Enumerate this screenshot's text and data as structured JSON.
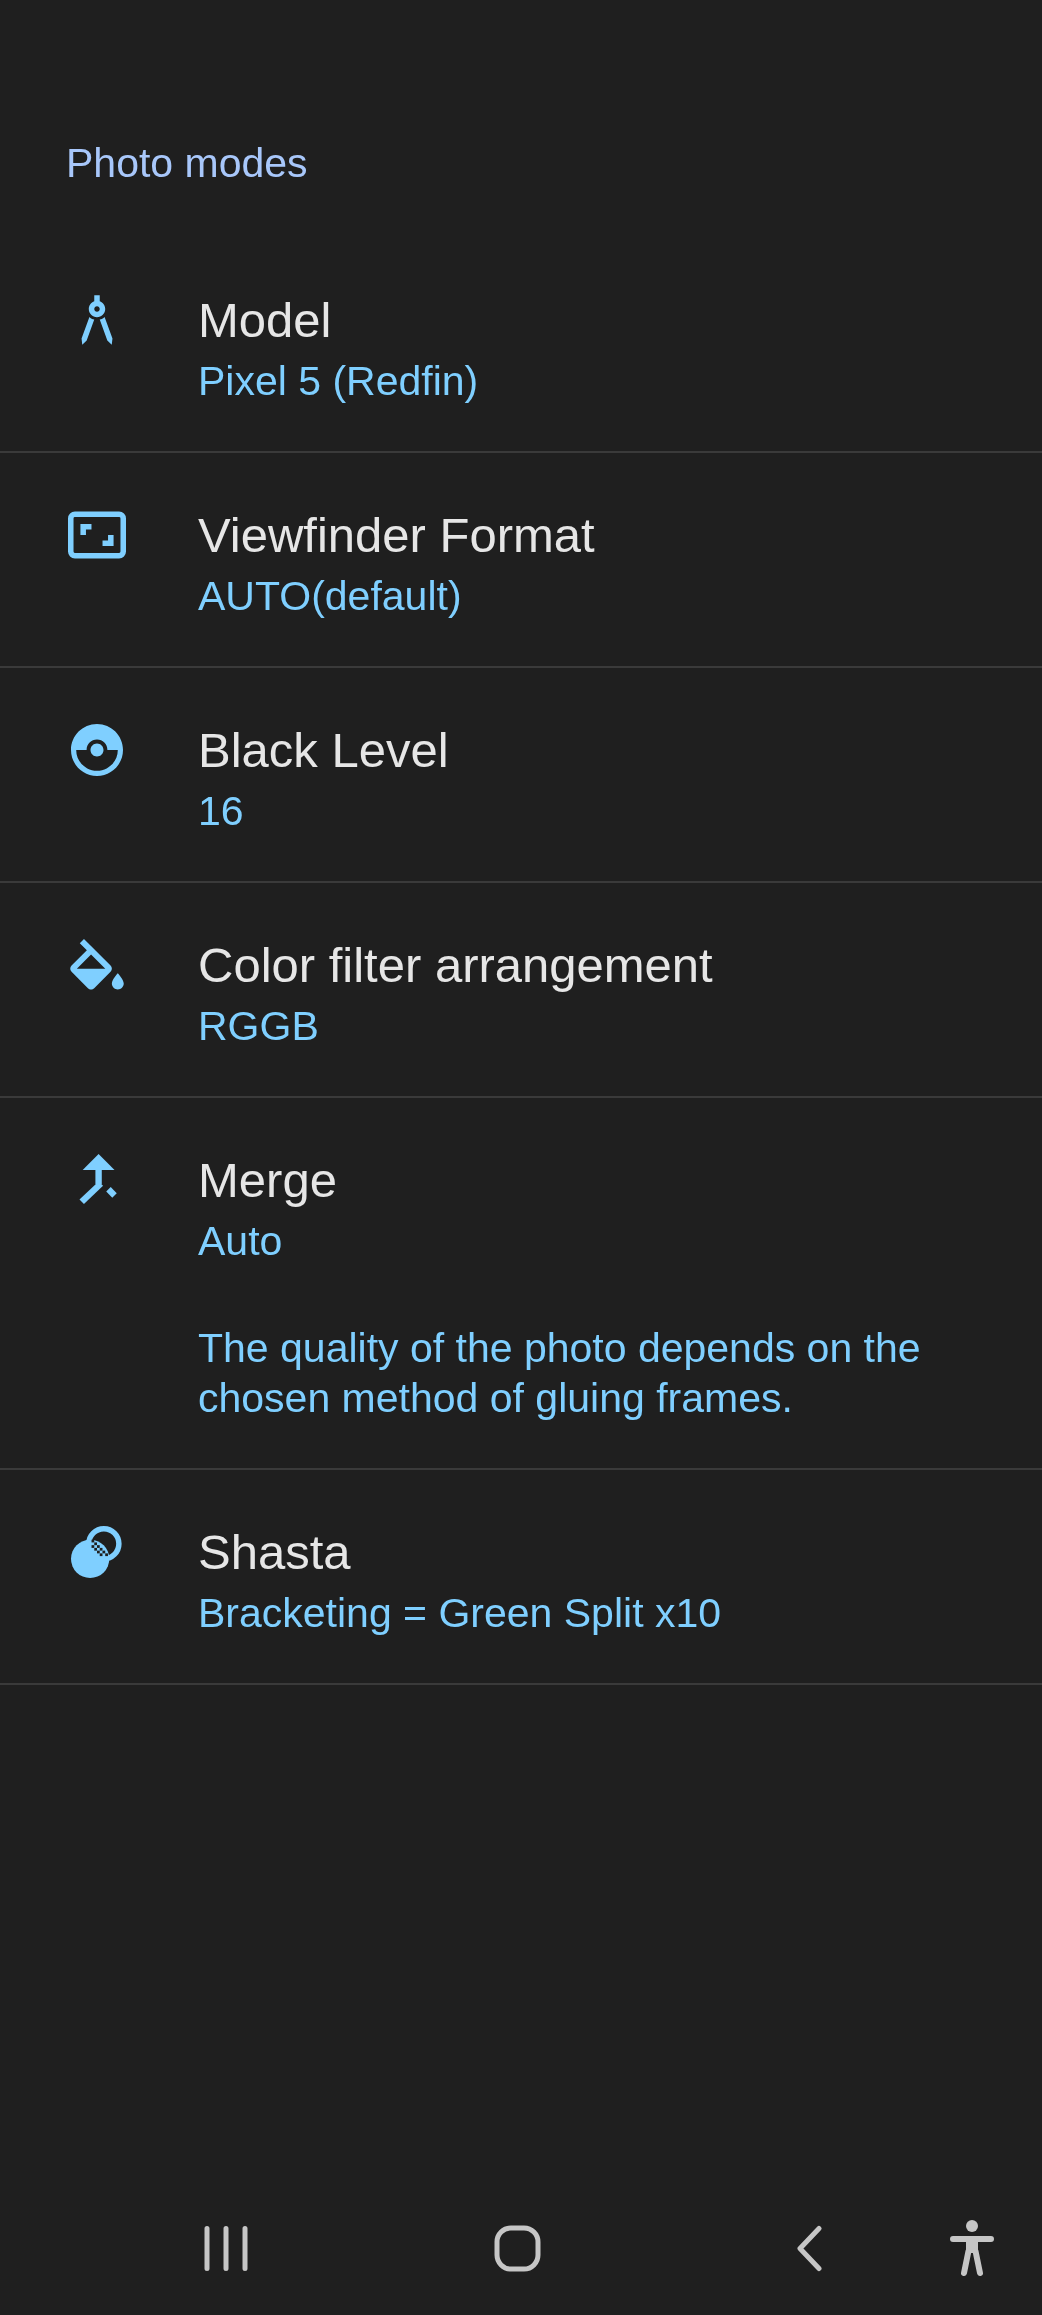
{
  "header": {
    "title": "Photo modes"
  },
  "settings": [
    {
      "title": "Model",
      "value": "Pixel 5 (Redfin)"
    },
    {
      "title": "Viewfinder Format",
      "value": "AUTO(default)"
    },
    {
      "title": "Black Level",
      "value": "16"
    },
    {
      "title": "Color filter arrangement",
      "value": "RGGB"
    },
    {
      "title": "Merge",
      "value": "Auto",
      "description": "The quality of the photo depends on the chosen method of gluing frames."
    },
    {
      "title": "Shasta",
      "value": "Bracketing = Green Split x10"
    }
  ]
}
